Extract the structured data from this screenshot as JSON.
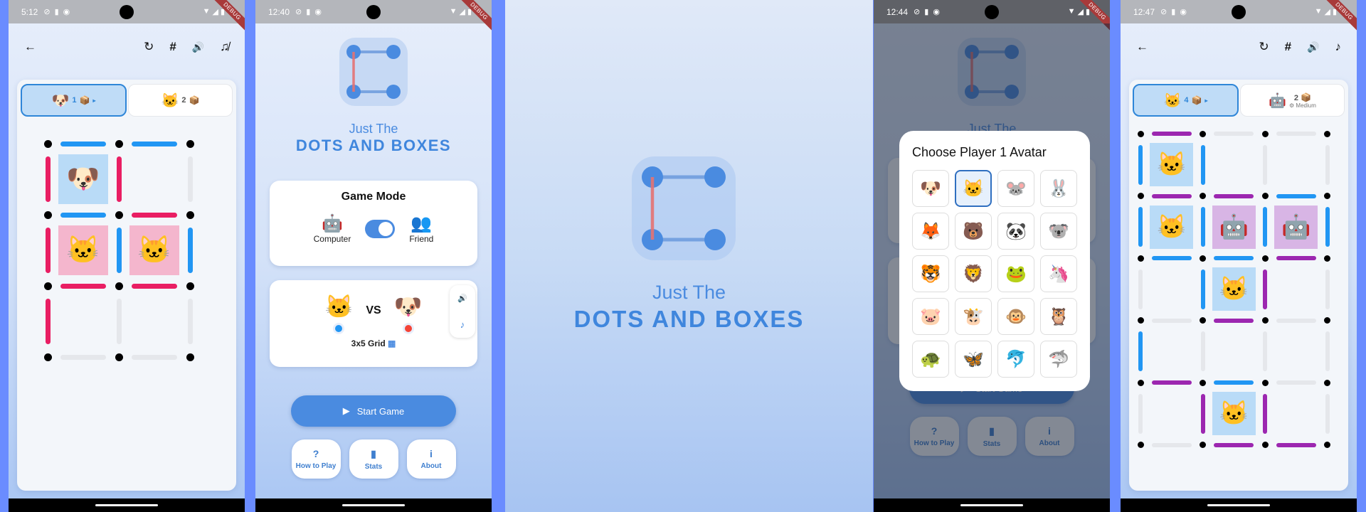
{
  "colors": {
    "background": "#6a8cff",
    "player_blue": "#2196f3",
    "player_red": "#e91e63",
    "player_purple": "#9c27b0",
    "empty_line": "#e5e7eb",
    "box_blue": "#b9dbf7",
    "box_pink": "#f4b6cd",
    "box_purple": "#d8b5e5",
    "accent": "#4a8be0"
  },
  "screens": [
    {
      "id": "game1",
      "status": {
        "time": "5:12",
        "icons": [
          "shield-icon",
          "sim-icon",
          "face-icon"
        ],
        "debug": "DEBUG"
      },
      "toolbar": {
        "back": "←",
        "restart": "↻",
        "grid": "#",
        "sound": "🔊",
        "music": "♫̸"
      },
      "players": [
        {
          "avatar": "🐶",
          "score": "1",
          "box": "📦",
          "active": true,
          "turn": "▸"
        },
        {
          "avatar": "🐱",
          "score": "2",
          "box": "📦",
          "active": false
        }
      ],
      "grid": {
        "rows": 3,
        "cols": 2,
        "h_lines": [
          [
            "blue",
            "blue"
          ],
          [
            "blue",
            "red"
          ],
          [
            "red",
            "red"
          ],
          [
            "empty",
            "empty"
          ]
        ],
        "v_lines": [
          [
            "red",
            "red",
            "empty"
          ],
          [
            "red",
            "blue",
            "blue"
          ],
          [
            "red",
            "empty",
            "empty"
          ]
        ],
        "boxes": [
          [
            {
              "owner": "blue",
              "emoji": "🐶"
            },
            null
          ],
          [
            {
              "owner": "pink",
              "emoji": "🐱"
            },
            {
              "owner": "pink",
              "emoji": "🐱"
            }
          ],
          [
            null,
            null
          ]
        ]
      }
    },
    {
      "id": "home",
      "status": {
        "time": "12:40",
        "debug": "DEBUG"
      },
      "title_light": "Just The",
      "title_bold": "DOTS AND BOXES",
      "game_mode": {
        "title": "Game Mode",
        "left": {
          "emoji": "🤖",
          "label": "Computer"
        },
        "right": {
          "emoji": "👥",
          "label": "Friend"
        },
        "toggle_on": true
      },
      "matchup": {
        "p1": "🐱",
        "vs": "VS",
        "p2": "🐶",
        "p1_color": "#2196f3",
        "p2_color": "#f44336",
        "grid_label": "3x5 Grid",
        "grid_icon": "▦"
      },
      "side_controls": {
        "sound": "🔊",
        "music": "♪"
      },
      "start": {
        "icon": "▶",
        "label": "Start Game"
      },
      "buttons": [
        {
          "icon": "?",
          "label": "How to Play"
        },
        {
          "icon": "▮",
          "label": "Stats"
        },
        {
          "icon": "i",
          "label": "About"
        }
      ]
    },
    {
      "id": "splash",
      "title_light": "Just The",
      "title_bold": "DOTS AND BOXES"
    },
    {
      "id": "avatar_dialog",
      "status": {
        "time": "12:44",
        "debug": "DEBUG"
      },
      "dialog_title": "Choose Player 1 Avatar",
      "selected_index": 1,
      "avatars": [
        "🐶",
        "🐱",
        "🐭",
        "🐰",
        "🦊",
        "🐻",
        "🐼",
        "🐨",
        "🐯",
        "🦁",
        "🐸",
        "🦄",
        "🐷",
        "🐮",
        "🐵",
        "🦉",
        "🐢",
        "🦋",
        "🐬",
        "🦈"
      ],
      "start": {
        "icon": "▶",
        "label": "Start Game"
      },
      "buttons": [
        {
          "icon": "?",
          "label": "How to Play"
        },
        {
          "icon": "▮",
          "label": "Stats"
        },
        {
          "icon": "i",
          "label": "About"
        }
      ]
    },
    {
      "id": "game2",
      "status": {
        "time": "12:47",
        "debug": "DEBUG"
      },
      "toolbar": {
        "back": "←",
        "restart": "↻",
        "grid": "#",
        "sound": "🔊",
        "music": "♪"
      },
      "players": [
        {
          "avatar": "🐱",
          "score": "4",
          "box": "📦",
          "active": true,
          "turn": "▸"
        },
        {
          "avatar": "🤖",
          "score": "2",
          "box": "📦",
          "active": false,
          "difficulty": "⚙ Medium"
        }
      ],
      "grid": {
        "rows": 5,
        "cols": 3,
        "h_lines": [
          [
            "purple",
            "empty",
            "empty"
          ],
          [
            "purple",
            "purple",
            "blue"
          ],
          [
            "blue",
            "blue",
            "purple"
          ],
          [
            "empty",
            "purple",
            "empty"
          ],
          [
            "purple",
            "blue",
            "empty"
          ],
          [
            "empty",
            "purple",
            "purple"
          ]
        ],
        "v_lines": [
          [
            "blue",
            "blue",
            "empty",
            "empty"
          ],
          [
            "blue",
            "blue",
            "blue",
            "blue"
          ],
          [
            "empty",
            "blue",
            "purple",
            "empty"
          ],
          [
            "blue",
            "empty",
            "empty",
            "empty"
          ],
          [
            "empty",
            "purple",
            "purple",
            "empty"
          ]
        ],
        "boxes": [
          [
            {
              "owner": "blue",
              "emoji": "🐱"
            },
            null,
            null
          ],
          [
            {
              "owner": "blue",
              "emoji": "🐱"
            },
            {
              "owner": "purple",
              "emoji": "🤖"
            },
            {
              "owner": "purple",
              "emoji": "🤖"
            }
          ],
          [
            null,
            {
              "owner": "blue",
              "emoji": "🐱"
            },
            null
          ],
          [
            null,
            null,
            null
          ],
          [
            null,
            {
              "owner": "blue",
              "emoji": "🐱"
            },
            null
          ]
        ]
      }
    }
  ]
}
